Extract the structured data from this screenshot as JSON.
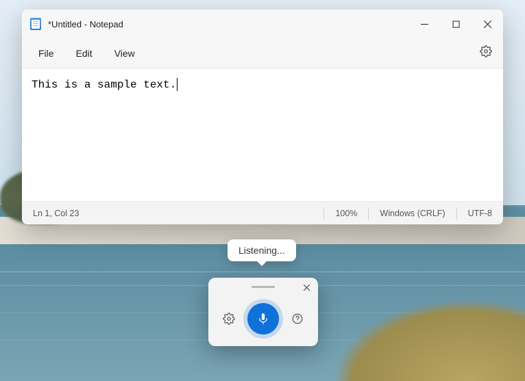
{
  "window": {
    "title": "*Untitled - Notepad"
  },
  "menu": {
    "file": "File",
    "edit": "Edit",
    "view": "View"
  },
  "editor": {
    "content": "This is a sample text."
  },
  "status": {
    "position": "Ln 1, Col 23",
    "zoom": "100%",
    "lineending": "Windows (CRLF)",
    "encoding": "UTF-8"
  },
  "voice": {
    "tooltip": "Listening..."
  }
}
